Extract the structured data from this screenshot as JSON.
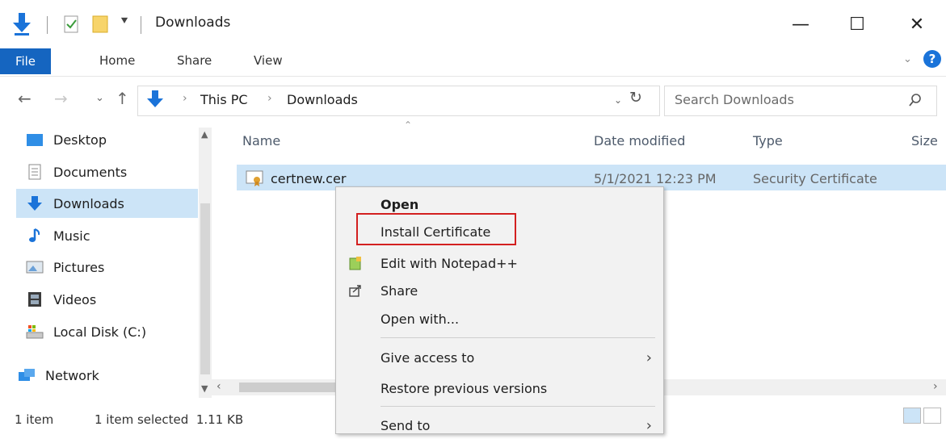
{
  "window": {
    "title": "Downloads",
    "controls": {
      "minimize": "—",
      "maximize": "☐",
      "close": "✕"
    }
  },
  "ribbon": {
    "tabs": [
      {
        "label": "File",
        "active": true
      },
      {
        "label": "Home"
      },
      {
        "label": "Share"
      },
      {
        "label": "View"
      }
    ],
    "help_icon": "help-icon",
    "accent_color": "#1565c0"
  },
  "address": {
    "crumbs": [
      "This PC",
      "Downloads"
    ],
    "search_placeholder": "Search Downloads"
  },
  "nav_pane": {
    "items": [
      {
        "label": "Desktop",
        "icon": "desktop-folder-icon"
      },
      {
        "label": "Documents",
        "icon": "documents-folder-icon"
      },
      {
        "label": "Downloads",
        "icon": "downloads-folder-icon",
        "selected": true
      },
      {
        "label": "Music",
        "icon": "music-folder-icon"
      },
      {
        "label": "Pictures",
        "icon": "pictures-folder-icon"
      },
      {
        "label": "Videos",
        "icon": "videos-folder-icon"
      },
      {
        "label": "Local Disk (C:)",
        "icon": "local-disk-icon"
      },
      {
        "label": "Network",
        "icon": "network-icon"
      }
    ]
  },
  "file_list": {
    "columns": [
      "Name",
      "Date modified",
      "Type",
      "Size"
    ],
    "rows": [
      {
        "name": "certnew.cer",
        "date_modified": "5/1/2021 12:23 PM",
        "type": "Security Certificate",
        "selected": true
      }
    ]
  },
  "context_menu": {
    "items": [
      {
        "label": "Open",
        "bold": true
      },
      {
        "label": "Install Certificate",
        "highlighted": true
      },
      {
        "label": "Edit with Notepad++",
        "icon": "notepad-plus-plus-icon"
      },
      {
        "label": "Share",
        "icon": "share-icon"
      },
      {
        "label": "Open with..."
      },
      {
        "label": "Give access to",
        "submenu": true
      },
      {
        "label": "Restore previous versions"
      },
      {
        "label": "Send to",
        "submenu": true
      }
    ],
    "highlight_color": "#d32020"
  },
  "status_bar": {
    "item_count": "1 item",
    "selection": "1 item selected  1.11 KB"
  }
}
